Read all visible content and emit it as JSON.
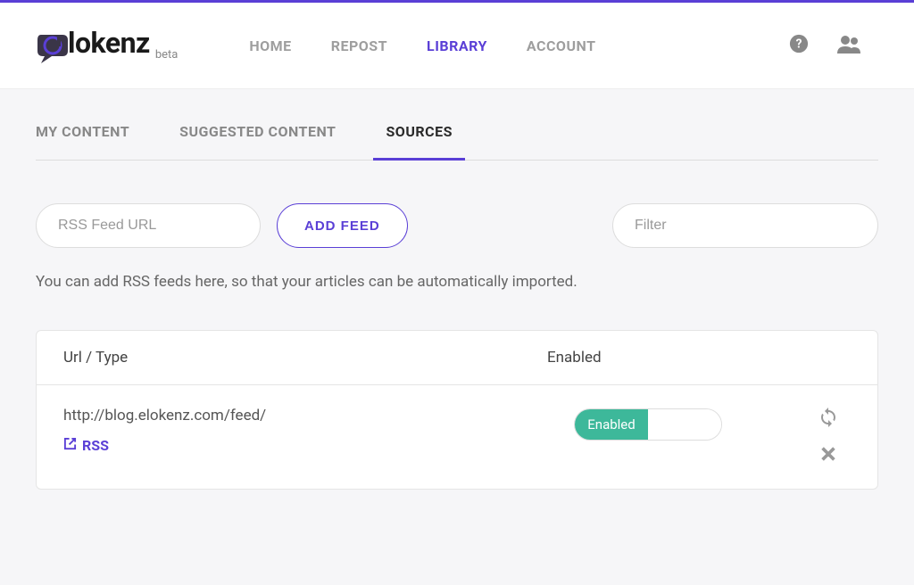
{
  "brand": {
    "name": "lokenz",
    "tag": "beta"
  },
  "nav": {
    "home": "HOME",
    "repost": "REPOST",
    "library": "LIBRARY",
    "account": "ACCOUNT"
  },
  "tabs": {
    "my_content": "MY CONTENT",
    "suggested": "SUGGESTED CONTENT",
    "sources": "SOURCES"
  },
  "controls": {
    "rss_placeholder": "RSS Feed URL",
    "add_feed": "ADD FEED",
    "filter_placeholder": "Filter"
  },
  "help_text": "You can add RSS feeds here, so that your articles can be automatically imported.",
  "table": {
    "header_url": "Url / Type",
    "header_enabled": "Enabled"
  },
  "feeds": [
    {
      "url": "http://blog.elokenz.com/feed/",
      "type_label": "RSS",
      "enabled_label": "Enabled"
    }
  ]
}
